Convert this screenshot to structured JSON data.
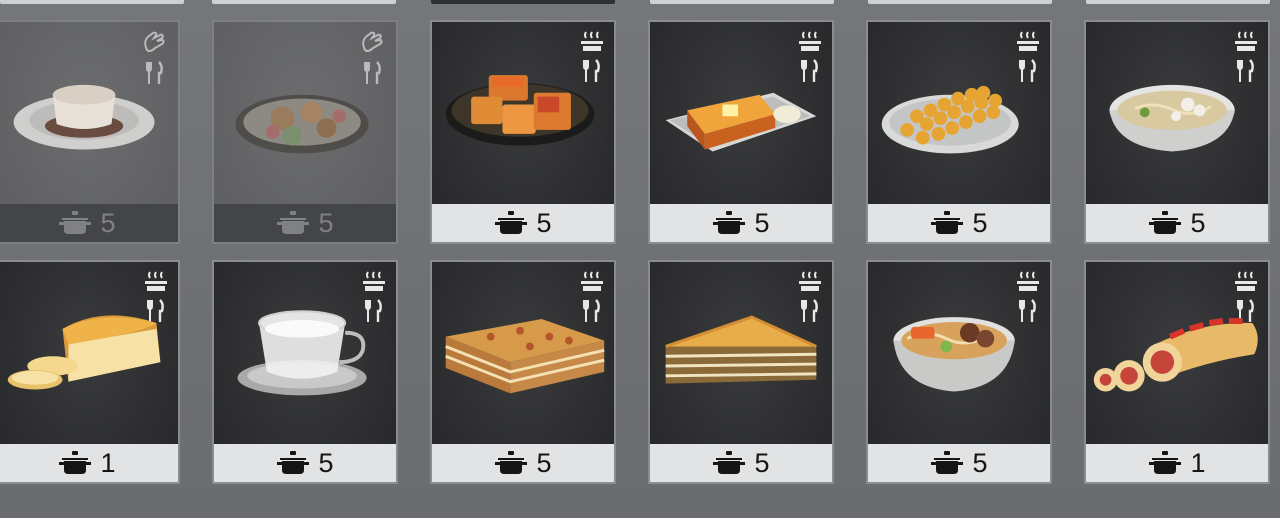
{
  "dishes": [
    {
      "name": "pudding-dish-icon",
      "count": "5",
      "state": "locked"
    },
    {
      "name": "gingerbread-cookies-dish-icon",
      "count": "5",
      "state": "locked"
    },
    {
      "name": "pineapple-cakes-dish-icon",
      "count": "5",
      "state": "available"
    },
    {
      "name": "french-toast-dish-icon",
      "count": "5",
      "state": "available"
    },
    {
      "name": "egg-waffle-dish-icon",
      "count": "5",
      "state": "available"
    },
    {
      "name": "noodle-soup-dish-icon",
      "count": "5",
      "state": "available"
    },
    {
      "name": "bread-loaf-dish-icon",
      "count": "1",
      "state": "available"
    },
    {
      "name": "cup-of-milk-dish-icon",
      "count": "5",
      "state": "available"
    },
    {
      "name": "lasagna-dish-icon",
      "count": "5",
      "state": "available"
    },
    {
      "name": "pie-slice-dish-icon",
      "count": "5",
      "state": "available"
    },
    {
      "name": "ramen-bowl-dish-icon",
      "count": "5",
      "state": "available"
    },
    {
      "name": "meat-roll-dish-icon",
      "count": "1",
      "state": "available"
    }
  ],
  "icons": {
    "locked_top": "hand-icon",
    "available_top": "steaming-pot-icon",
    "utensil": "fork-knife-icon",
    "footer": "cooking-pot-icon"
  },
  "colors": {
    "card_bg": "#2b2c2e",
    "footer_bg": "#e2e3e4",
    "locked_card_bg": "#5f6062"
  }
}
